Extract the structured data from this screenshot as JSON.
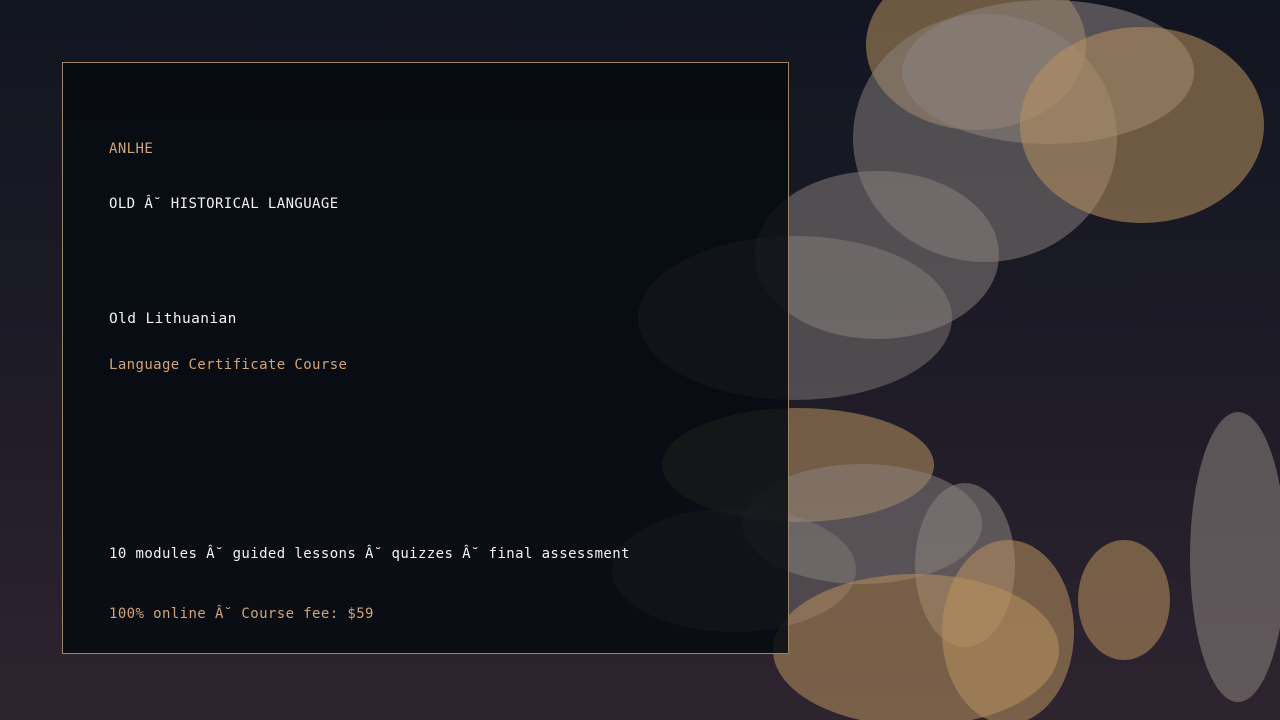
{
  "brand": "ANLHE",
  "category": "OLD Â˘ HISTORICAL LANGUAGE",
  "course": {
    "title": "Old Lithuanian",
    "subtitle": "Language Certificate Course"
  },
  "details": "10 modules Â˘ guided lessons Â˘ quizzes Â˘ final assessment",
  "pricing": "100% online Â˘ Course fee: $59",
  "colors": {
    "accent_gold": "#d2a478",
    "text_white": "#f2f2f2",
    "card_border": "#9c8466",
    "bokeh_gold": "#b8915f",
    "bokeh_gray": "#8c8480"
  }
}
